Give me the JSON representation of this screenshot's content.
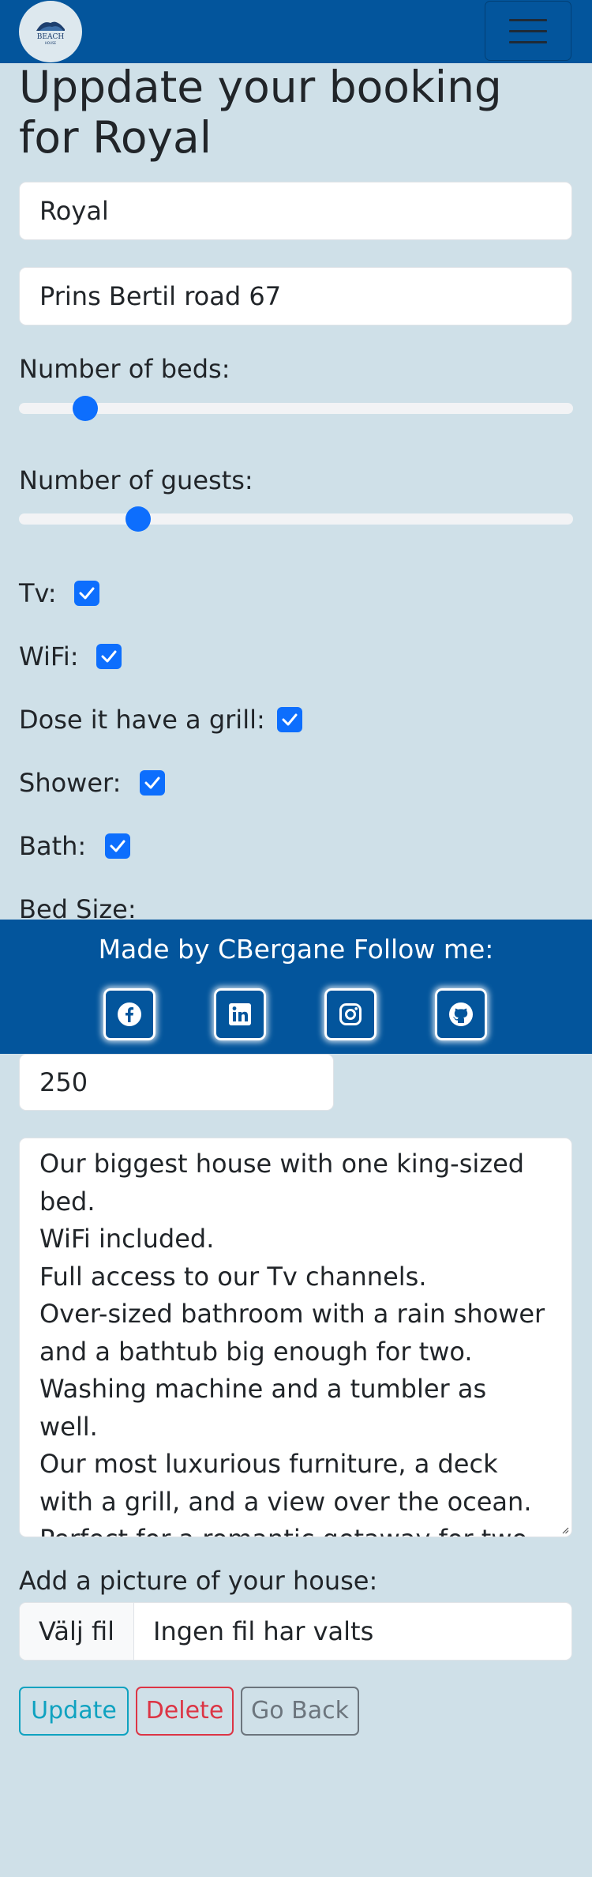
{
  "navbar": {
    "logo_text": "BEACH",
    "logo_subtext": "HOUSE",
    "menu_icon": "hamburger-icon",
    "brand_color": "#03559c"
  },
  "page": {
    "title": "Uppdate your booking for Royal"
  },
  "form": {
    "name_value": "Royal",
    "address_value": "Prins Bertil road 67",
    "beds": {
      "label": "Number of beds:",
      "level": 0.12
    },
    "guests": {
      "label": "Number of guests:",
      "level": 0.215
    },
    "amenities": [
      {
        "label": "Tv:",
        "checked": true
      },
      {
        "label": "WiFi:",
        "checked": true
      },
      {
        "label": "Dose it have a grill:",
        "checked": true
      },
      {
        "label": "Shower:",
        "checked": true
      },
      {
        "label": "Bath:",
        "checked": true
      }
    ],
    "bed_size_label": "Bed Size:",
    "price_value": "250",
    "description": "Our biggest house with one king-sized bed.\nWiFi included.\nFull access to our Tv channels.\nOver-sized bathroom with a rain shower and a bathtub big enough for two.\nWashing machine and a tumbler as well.\nOur most luxurious furniture, a deck with a grill, and a view over the ocean.\nPerfect for a romantic getaway for two.",
    "picture_label": "Add a picture of your house:",
    "file_button": "Välj fil",
    "file_status": "Ingen fil har valts"
  },
  "buttons": {
    "update": "Update",
    "delete": "Delete",
    "back": "Go Back"
  },
  "footer": {
    "text": "Made by CBergane Follow me:",
    "social": [
      {
        "name": "facebook-icon"
      },
      {
        "name": "linkedin-icon"
      },
      {
        "name": "instagram-icon"
      },
      {
        "name": "github-icon"
      }
    ]
  },
  "colors": {
    "background": "#cfe0e8",
    "accent": "#0d6efd",
    "info": "#0fa2c0",
    "danger": "#dc3545",
    "secondary": "#6c757d"
  }
}
